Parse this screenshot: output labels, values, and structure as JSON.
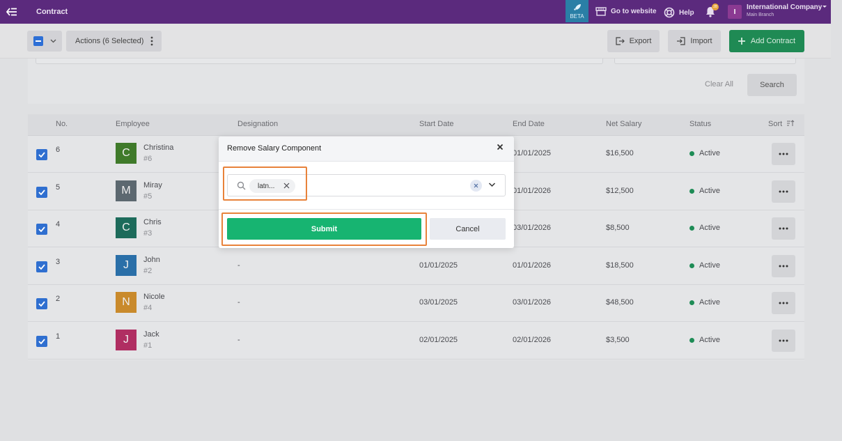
{
  "topbar": {
    "title": "Contract",
    "beta_label": "BETA",
    "website_label": "Go to website",
    "help_label": "Help",
    "notification_count": "28",
    "user_initial": "I",
    "company_name": "International Company",
    "branch_name": "Main Branch",
    "colors": {
      "bar": "#5b2a7d",
      "beta": "#2a7fa6"
    }
  },
  "toolbar": {
    "actions_label": "Actions (6 Selected)",
    "export_label": "Export",
    "import_label": "Import",
    "add_label": "Add Contract"
  },
  "filters": {
    "clear_all_label": "Clear All",
    "search_label": "Search"
  },
  "table": {
    "columns": [
      "No.",
      "Employee",
      "Designation",
      "Start Date",
      "End Date",
      "Net Salary",
      "Status",
      "Sort"
    ],
    "rows": [
      {
        "no": "6",
        "initial": "C",
        "avatar_color": "#3f7a2a",
        "name": "Christina",
        "id": "#6",
        "designation": "",
        "start": "",
        "end": "01/01/2025",
        "salary": "$16,500",
        "status": "Active"
      },
      {
        "no": "5",
        "initial": "M",
        "avatar_color": "#5c6870",
        "name": "Miray",
        "id": "#5",
        "designation": "",
        "start": "",
        "end": "01/01/2026",
        "salary": "$12,500",
        "status": "Active"
      },
      {
        "no": "4",
        "initial": "C",
        "avatar_color": "#1d6b5b",
        "name": "Chris",
        "id": "#3",
        "designation": "",
        "start": "",
        "end": "03/01/2026",
        "salary": "$8,500",
        "status": "Active"
      },
      {
        "no": "3",
        "initial": "J",
        "avatar_color": "#2a6fa8",
        "name": "John",
        "id": "#2",
        "designation": "-",
        "start": "01/01/2025",
        "end": "01/01/2026",
        "salary": "$18,500",
        "status": "Active"
      },
      {
        "no": "2",
        "initial": "N",
        "avatar_color": "#c98a2c",
        "name": "Nicole",
        "id": "#4",
        "designation": "-",
        "start": "03/01/2025",
        "end": "03/01/2026",
        "salary": "$48,500",
        "status": "Active"
      },
      {
        "no": "1",
        "initial": "J",
        "avatar_color": "#b02e62",
        "name": "Jack",
        "id": "#1",
        "designation": "-",
        "start": "02/01/2025",
        "end": "02/01/2026",
        "salary": "$3,500",
        "status": "Active"
      }
    ]
  },
  "modal": {
    "title": "Remove Salary Component",
    "chip_label": "latn...",
    "submit_label": "Submit",
    "cancel_label": "Cancel",
    "colors": {
      "submit": "#17b471",
      "highlight": "#e8823a"
    }
  }
}
